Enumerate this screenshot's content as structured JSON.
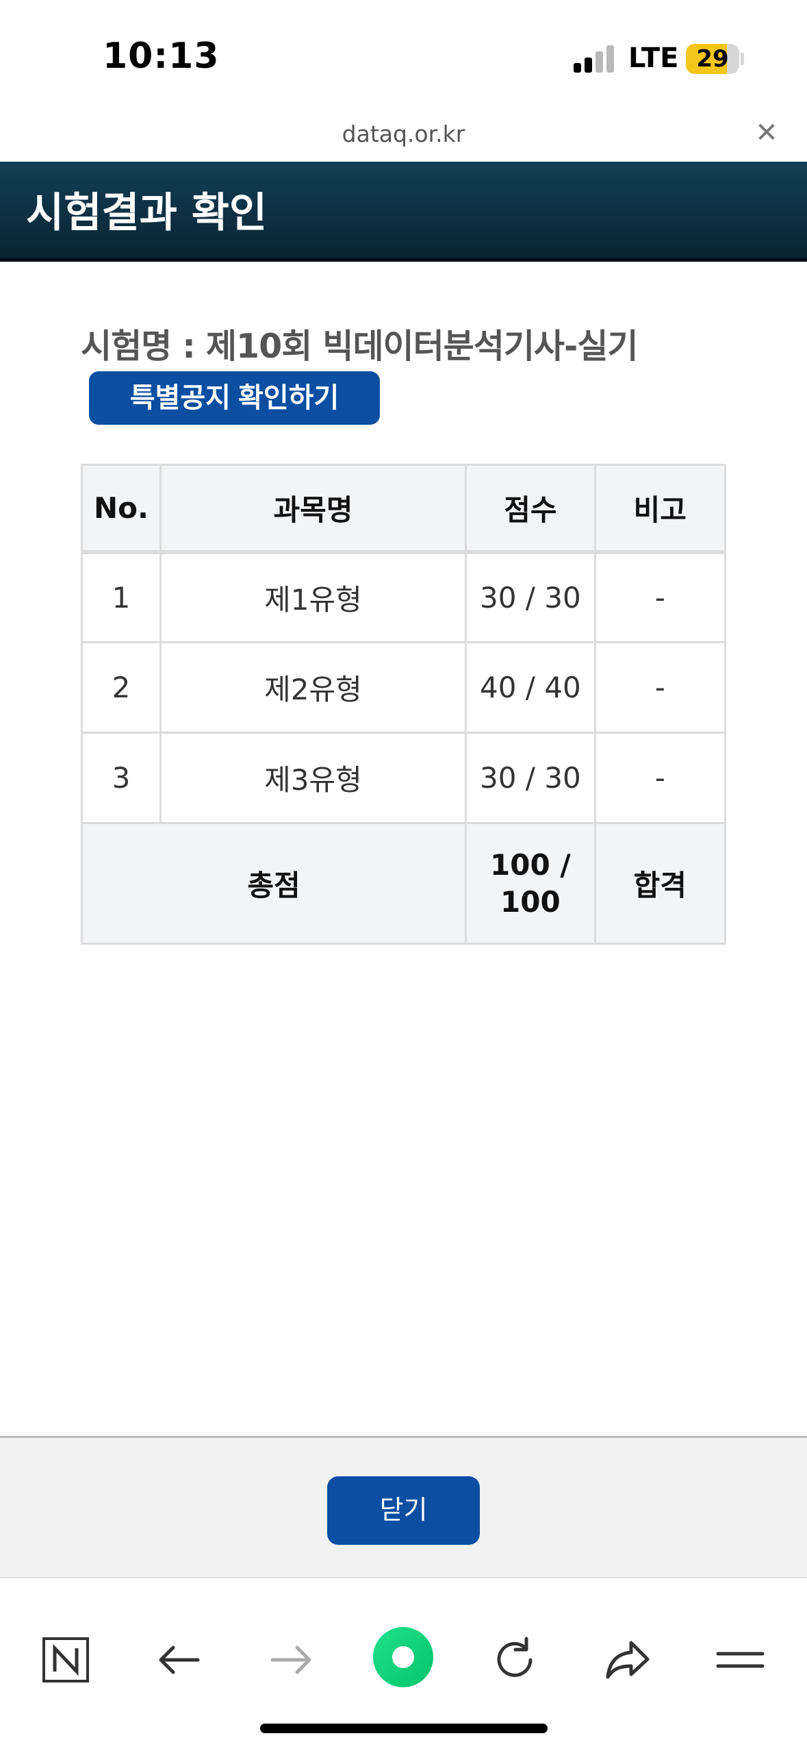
{
  "status_bar": {
    "time": "10:13",
    "network": "LTE",
    "battery_level": "29",
    "signal_bars_active": 2,
    "signal_bars_total": 4
  },
  "browser": {
    "url": "dataq.or.kr",
    "close_icon": "close-icon"
  },
  "header": {
    "title": "시험결과 확인",
    "background_color": "#0f3447"
  },
  "exam": {
    "name": "시험명 : 제10회 빅데이터분석기사-실기",
    "notice_button": "특별공지 확인하기"
  },
  "table": {
    "headers": {
      "no": "No.",
      "subject": "과목명",
      "score": "점수",
      "note": "비고"
    },
    "rows": [
      {
        "no": "1",
        "subject": "제1유형",
        "score": "30 / 30",
        "note": "-"
      },
      {
        "no": "2",
        "subject": "제2유형",
        "score": "40 / 40",
        "note": "-"
      },
      {
        "no": "3",
        "subject": "제3유형",
        "score": "30 / 30",
        "note": "-"
      }
    ],
    "total": {
      "label": "총점",
      "score_line1": "100 /",
      "score_line2": "100",
      "note": "합격"
    }
  },
  "actions": {
    "close_button": "닫기",
    "accent_color": "#0b4ea2"
  },
  "toolbar": {
    "icons": [
      "naver-n-icon",
      "back-arrow-icon",
      "forward-arrow-icon",
      "green-dot-home-icon",
      "reload-icon",
      "share-icon",
      "menu-icon"
    ]
  }
}
